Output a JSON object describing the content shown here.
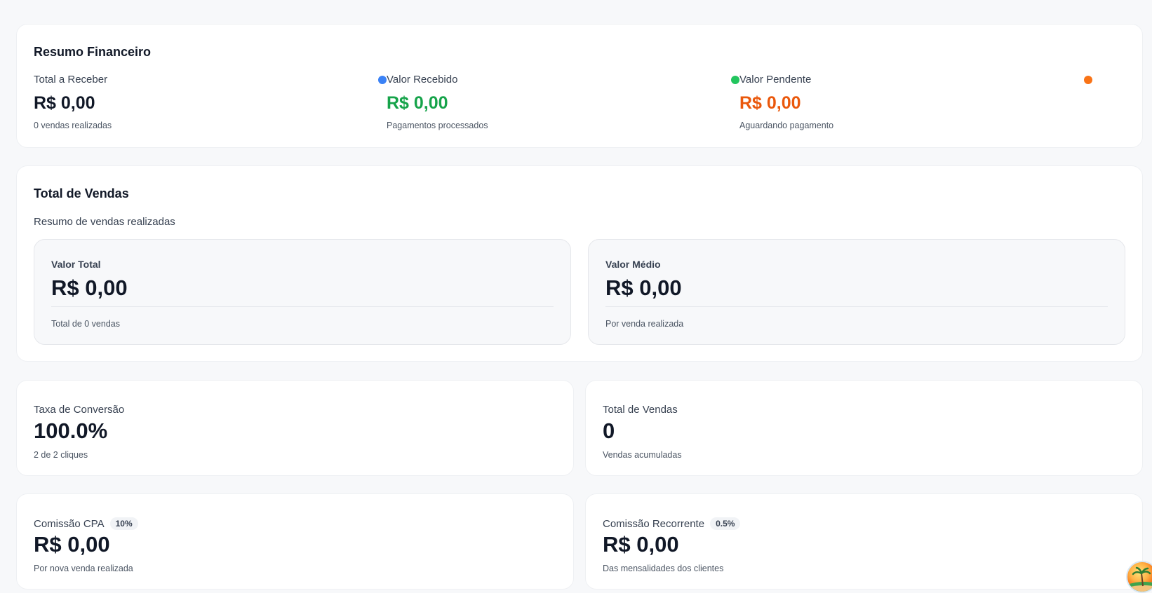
{
  "resumo": {
    "title": "Resumo Financeiro",
    "items": [
      {
        "label": "Total a Receber",
        "value": "R$ 0,00",
        "sub": "0 vendas realizadas",
        "color": "#111827",
        "dot": "#3b82f6"
      },
      {
        "label": "Valor Recebido",
        "value": "R$ 0,00",
        "sub": "Pagamentos processados",
        "color": "#16a34a",
        "dot": "#22c55e"
      },
      {
        "label": "Valor Pendente",
        "value": "R$ 0,00",
        "sub": "Aguardando pagamento",
        "color": "#ea580c",
        "dot": "#f97316"
      }
    ]
  },
  "vendas": {
    "title": "Total de Vendas",
    "description": "Resumo de vendas realizadas",
    "valor_total": {
      "label": "Valor Total",
      "value": "R$ 0,00",
      "sub": "Total de 0 vendas"
    },
    "valor_medio": {
      "label": "Valor Médio",
      "value": "R$ 0,00",
      "sub": "Por venda realizada"
    }
  },
  "conversao": {
    "label": "Taxa de Conversão",
    "value": "100.0%",
    "sub": "2 de 2 cliques"
  },
  "total_vendas": {
    "label": "Total de Vendas",
    "value": "0",
    "sub": "Vendas acumuladas"
  },
  "comissao_cpa": {
    "label": "Comissão CPA",
    "badge": "10%",
    "value": "R$ 0,00",
    "sub": "Por nova venda realizada"
  },
  "comissao_recorrente": {
    "label": "Comissão Recorrente",
    "badge": "0.5%",
    "value": "R$ 0,00",
    "sub": "Das mensalidades dos clientes"
  },
  "avatar": {
    "icon": "beach-palm-icon"
  }
}
